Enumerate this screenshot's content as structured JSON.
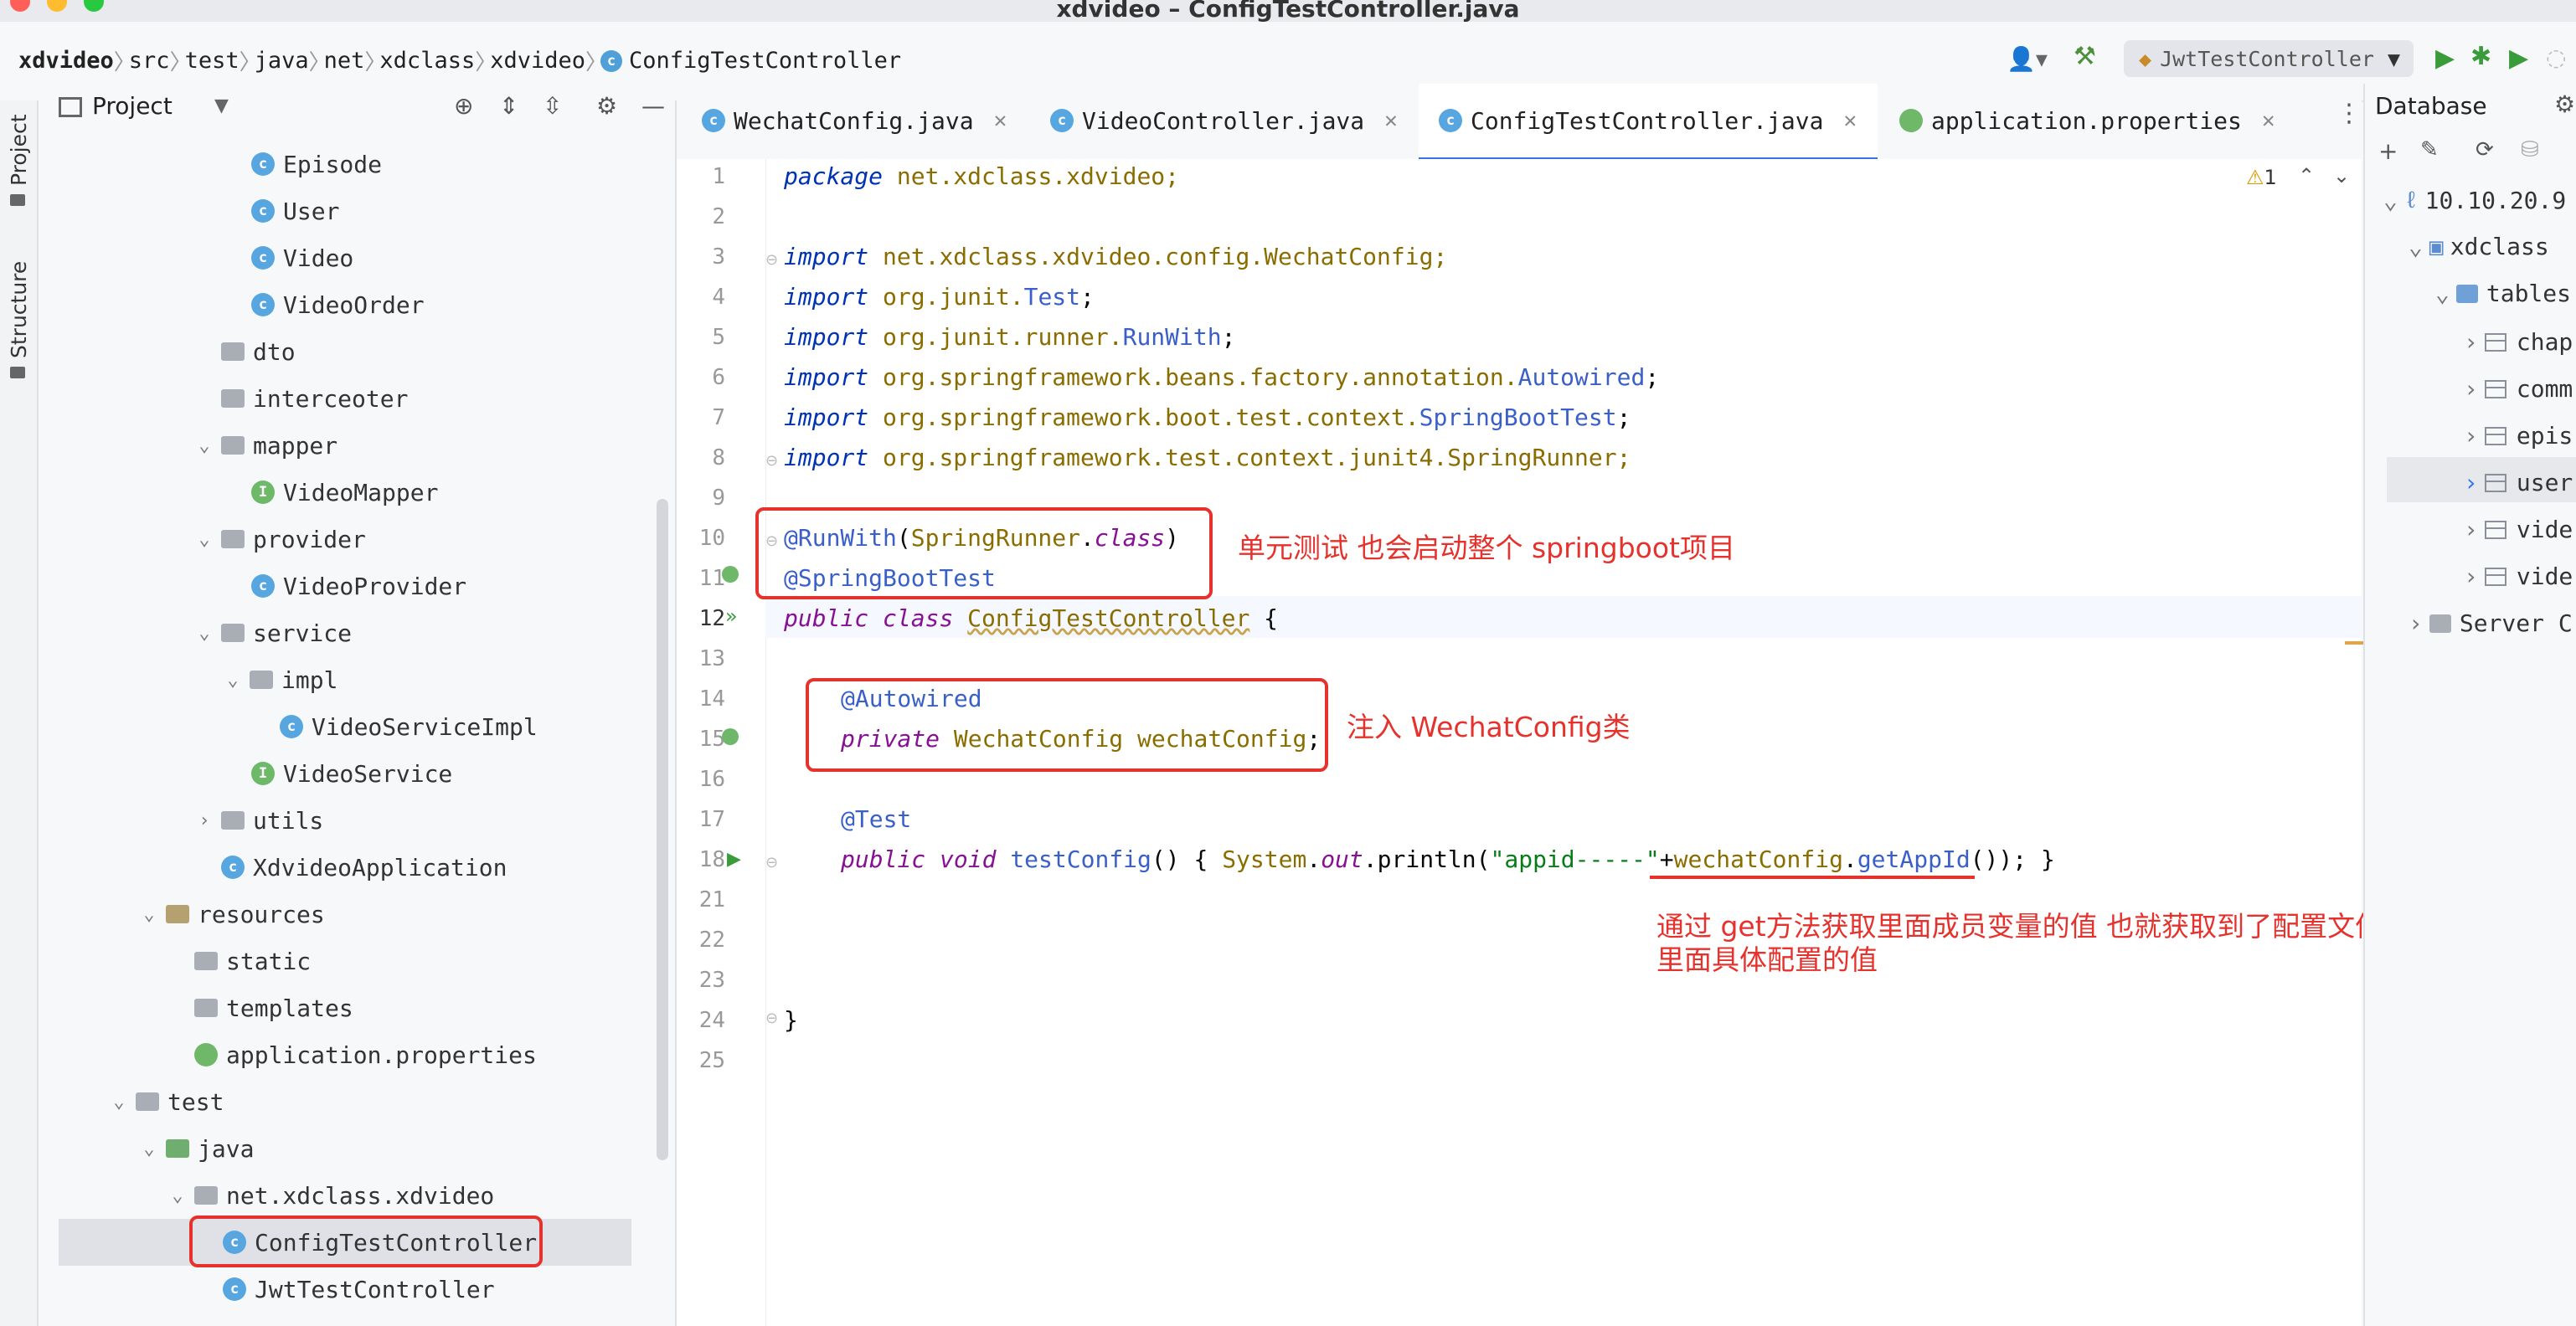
{
  "window": {
    "title": "xdvideo – ConfigTestController.java"
  },
  "breadcrumb": [
    "xdvideo",
    "src",
    "test",
    "java",
    "net",
    "xdclass",
    "xdvideo",
    "ConfigTestController"
  ],
  "toolbar": {
    "run_config": "JwtTestController"
  },
  "left_strip": {
    "project_label": "Project",
    "structure_label": "Structure"
  },
  "project": {
    "header": "Project",
    "tree": [
      {
        "label": "Episode",
        "kind": "class",
        "depth": 5
      },
      {
        "label": "User",
        "kind": "class",
        "depth": 5
      },
      {
        "label": "Video",
        "kind": "class",
        "depth": 5
      },
      {
        "label": "VideoOrder",
        "kind": "class",
        "depth": 5
      },
      {
        "label": "dto",
        "kind": "package",
        "depth": 4
      },
      {
        "label": "interceoter",
        "kind": "package",
        "depth": 4
      },
      {
        "label": "mapper",
        "kind": "package",
        "depth": 4,
        "expanded": true
      },
      {
        "label": "VideoMapper",
        "kind": "interface",
        "depth": 5
      },
      {
        "label": "provider",
        "kind": "package",
        "depth": 4,
        "expanded": true
      },
      {
        "label": "VideoProvider",
        "kind": "class",
        "depth": 5
      },
      {
        "label": "service",
        "kind": "package",
        "depth": 4,
        "expanded": true
      },
      {
        "label": "impl",
        "kind": "package",
        "depth": 5,
        "expanded": true
      },
      {
        "label": "VideoServiceImpl",
        "kind": "class",
        "depth": 6
      },
      {
        "label": "VideoService",
        "kind": "interface",
        "depth": 5
      },
      {
        "label": "utils",
        "kind": "package",
        "depth": 4,
        "collapsed": true
      },
      {
        "label": "XdvideoApplication",
        "kind": "class",
        "depth": 4
      },
      {
        "label": "resources",
        "kind": "resources",
        "depth": 3,
        "expanded": true
      },
      {
        "label": "static",
        "kind": "folder",
        "depth": 4
      },
      {
        "label": "templates",
        "kind": "folder",
        "depth": 4
      },
      {
        "label": "application.properties",
        "kind": "properties",
        "depth": 4
      },
      {
        "label": "test",
        "kind": "folder",
        "depth": 2,
        "expanded": true
      },
      {
        "label": "java",
        "kind": "testsrc",
        "depth": 3,
        "expanded": true
      },
      {
        "label": "net.xdclass.xdvideo",
        "kind": "package",
        "depth": 4,
        "expanded": true
      },
      {
        "label": "ConfigTestController",
        "kind": "class",
        "depth": 5,
        "selected": true
      },
      {
        "label": "JwtTestController",
        "kind": "class",
        "depth": 5
      }
    ]
  },
  "tabs": [
    {
      "label": "WechatConfig.java"
    },
    {
      "label": "VideoController.java"
    },
    {
      "label": "ConfigTestController.java",
      "active": true
    },
    {
      "label": "application.properties"
    }
  ],
  "editor": {
    "warning_count": "1",
    "line_numbers": [
      "1",
      "2",
      "3",
      "4",
      "5",
      "6",
      "7",
      "8",
      "9",
      "10",
      "11",
      "12",
      "13",
      "14",
      "15",
      "16",
      "17",
      "18",
      "21",
      "22",
      "23",
      "24",
      "25"
    ],
    "lines": {
      "l1_kw": "package",
      "l1_rest": " net.xdclass.xdvideo;",
      "l3_kw": "import",
      "l3_rest": " net.xdclass.xdvideo.config.WechatConfig;",
      "l4_kw": "import",
      "l4_a": " org.junit.",
      "l4_b": "Test",
      "l4_c": ";",
      "l5_kw": "import",
      "l5_a": " org.junit.runner.",
      "l5_b": "RunWith",
      "l5_c": ";",
      "l6_kw": "import",
      "l6_a": " org.springframework.beans.factory.annotation.",
      "l6_b": "Autowired",
      "l6_c": ";",
      "l7_kw": "import",
      "l7_a": " org.springframework.boot.test.context.",
      "l7_b": "SpringBootTest",
      "l7_c": ";",
      "l8_kw": "import",
      "l8_a": " org.springframework.test.context.junit4.SpringRunner;",
      "l10_a": "@RunWith",
      "l10_b": "(",
      "l10_c": "SpringRunner",
      "l10_d": ".",
      "l10_e": "class",
      "l10_f": ")",
      "l11": "@SpringBootTest",
      "l12_a": "public",
      "l12_b": " ",
      "l12_c": "class",
      "l12_d": " ",
      "l12_e": "ConfigTestController",
      "l12_f": " {",
      "l14": "@Autowired",
      "l15_a": "private",
      "l15_b": " WechatConfig",
      "l15_c": " wechatConfig",
      "l15_d": ";",
      "l17": "@Test",
      "l18_a": "public",
      "l18_b": " ",
      "l18_c": "void",
      "l18_d": " ",
      "l18_e": "testConfig",
      "l18_f": "() { ",
      "l18_g": "System",
      "l18_h": ".",
      "l18_i": "out",
      "l18_j": ".println(",
      "l18_k": "\"appid-----\"",
      "l18_l": "+",
      "l18_m": "wechatConfig",
      "l18_n": ".",
      "l18_o": "getAppId",
      "l18_p": "()); }",
      "l24": "}"
    }
  },
  "annotations": {
    "note1": "单元测试 也会启动整个 springboot项目",
    "note2": "注入 WechatConfig类",
    "note3_line1": "通过 get方法获取里面成员变量的值 也就获取到了配置文件",
    "note3_line2": "里面具体配置的值",
    "color": "#e5322d"
  },
  "database": {
    "header": "Database",
    "rows": [
      {
        "label": "10.10.20.9"
      },
      {
        "label": "xdclass"
      },
      {
        "label": "tables"
      },
      {
        "label": "chap"
      },
      {
        "label": "comm"
      },
      {
        "label": "epis"
      },
      {
        "label": "user",
        "selected": true
      },
      {
        "label": "vide"
      },
      {
        "label": "vide"
      },
      {
        "label": "Server C"
      }
    ]
  }
}
